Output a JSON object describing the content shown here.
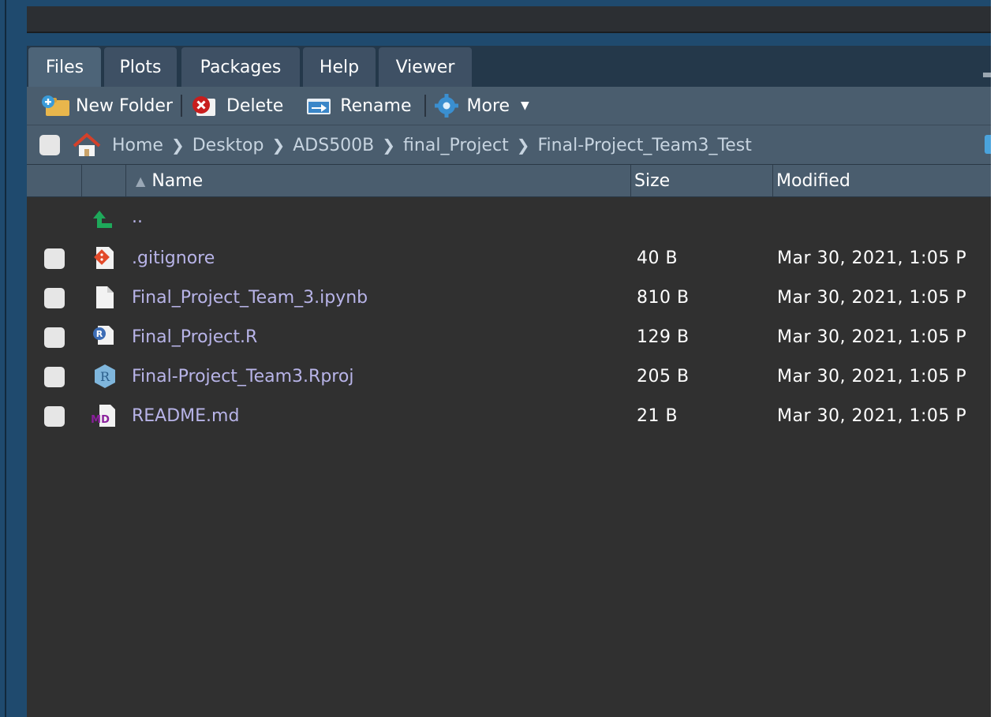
{
  "tabs": [
    "Files",
    "Plots",
    "Packages",
    "Help",
    "Viewer"
  ],
  "active_tab": "Files",
  "toolbar": {
    "new_folder": "New Folder",
    "delete": "Delete",
    "rename": "Rename",
    "more": "More"
  },
  "breadcrumb": [
    "Home",
    "Desktop",
    "ADS500B",
    "final_Project",
    "Final-Project_Team3_Test"
  ],
  "columns": {
    "name": "Name",
    "size": "Size",
    "modified": "Modified"
  },
  "parent_dir": "..",
  "files": [
    {
      "name": ".gitignore",
      "size": "40 B",
      "modified": "Mar 30, 2021, 1:05 P",
      "icon": "git-file-icon"
    },
    {
      "name": "Final_Project_Team_3.ipynb",
      "size": "810 B",
      "modified": "Mar 30, 2021, 1:05 P",
      "icon": "blank-file-icon"
    },
    {
      "name": "Final_Project.R",
      "size": "129 B",
      "modified": "Mar 30, 2021, 1:05 P",
      "icon": "r-script-icon"
    },
    {
      "name": "Final-Project_Team3.Rproj",
      "size": "205 B",
      "modified": "Mar 30, 2021, 1:05 P",
      "icon": "rproj-icon"
    },
    {
      "name": "README.md",
      "size": "21 B",
      "modified": "Mar 30, 2021, 1:05 P",
      "icon": "markdown-icon"
    }
  ],
  "colors": {
    "accent_link": "#b8b4e8",
    "toolbar_bg": "#4a5d6e",
    "pane_bg": "#303030"
  }
}
